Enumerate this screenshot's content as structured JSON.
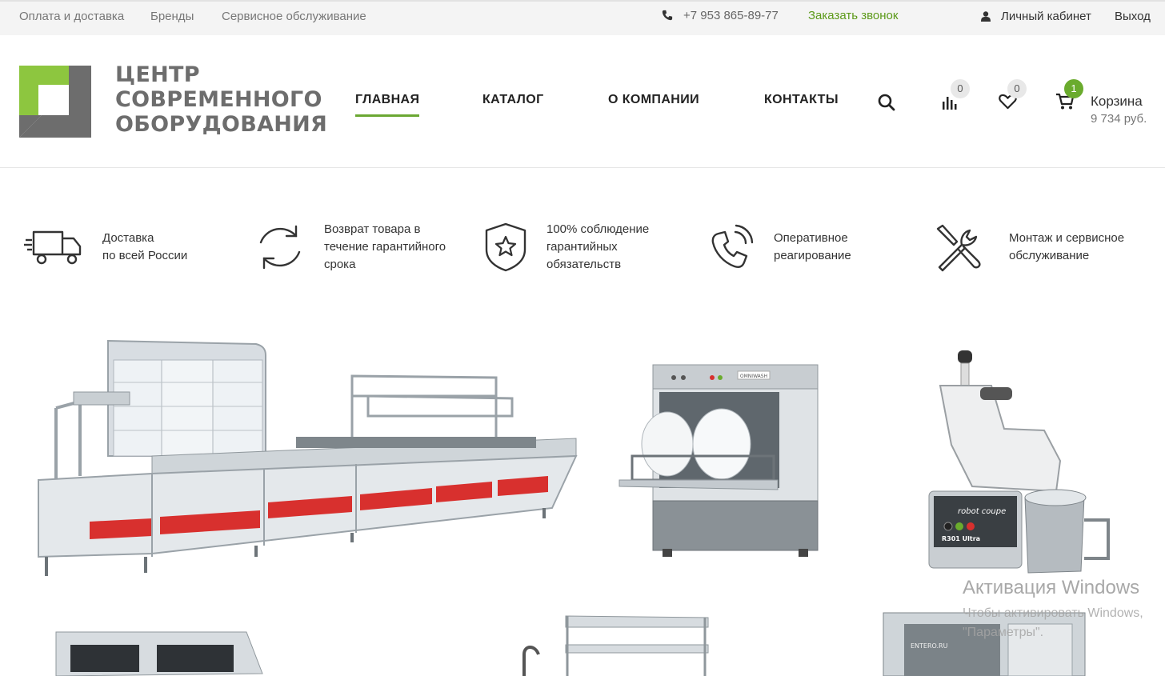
{
  "topbar": {
    "links": [
      "Оплата и доставка",
      "Бренды",
      "Сервисное обслуживание"
    ],
    "phone": "+7 953 865-89-77",
    "callback": "Заказать звонок",
    "cabinet": "Личный кабинет",
    "logout": "Выход"
  },
  "logo": {
    "line1": "ЦЕНТР",
    "line2": "СОВРЕМЕННОГО",
    "line3": "ОБОРУДОВАНИЯ"
  },
  "nav": {
    "home": "ГЛАВНАЯ",
    "catalog": "КАТАЛОГ",
    "about": "О КОМПАНИИ",
    "contacts": "КОНТАКТЫ"
  },
  "header_icons": {
    "compare_count": "0",
    "favorites_count": "0",
    "cart_count": "1",
    "cart_label": "Корзина",
    "cart_sum": "9 734 руб."
  },
  "features": [
    {
      "icon": "truck-icon",
      "text": "Доставка\nпо всей России"
    },
    {
      "icon": "refresh-icon",
      "text": "Возврат товара в\nтечение гарантийного\nсрока"
    },
    {
      "icon": "shield-star-icon",
      "text": "100% соблюдение\nгарантийных\nобязательств"
    },
    {
      "icon": "phone-call-icon",
      "text": "Оперативное\nреагирование"
    },
    {
      "icon": "tools-icon",
      "text": "Монтаж и сервисное\nобслуживание"
    }
  ],
  "products": {
    "dishwasher_brand": "OMNIWASH",
    "food_processor_brand": "robot coupe",
    "food_processor_model": "R301 Ultra",
    "oven_brand": "ENTERO.RU"
  },
  "watermark": {
    "title": "Активация Windows",
    "subtitle": "Чтобы активировать Windows,\n\"Параметры\"."
  },
  "colors": {
    "accent_green": "#6aa832",
    "topbar_bg": "#f4f4f4",
    "callback_green": "#5c9a1a",
    "counter_red": "#d8302e"
  }
}
